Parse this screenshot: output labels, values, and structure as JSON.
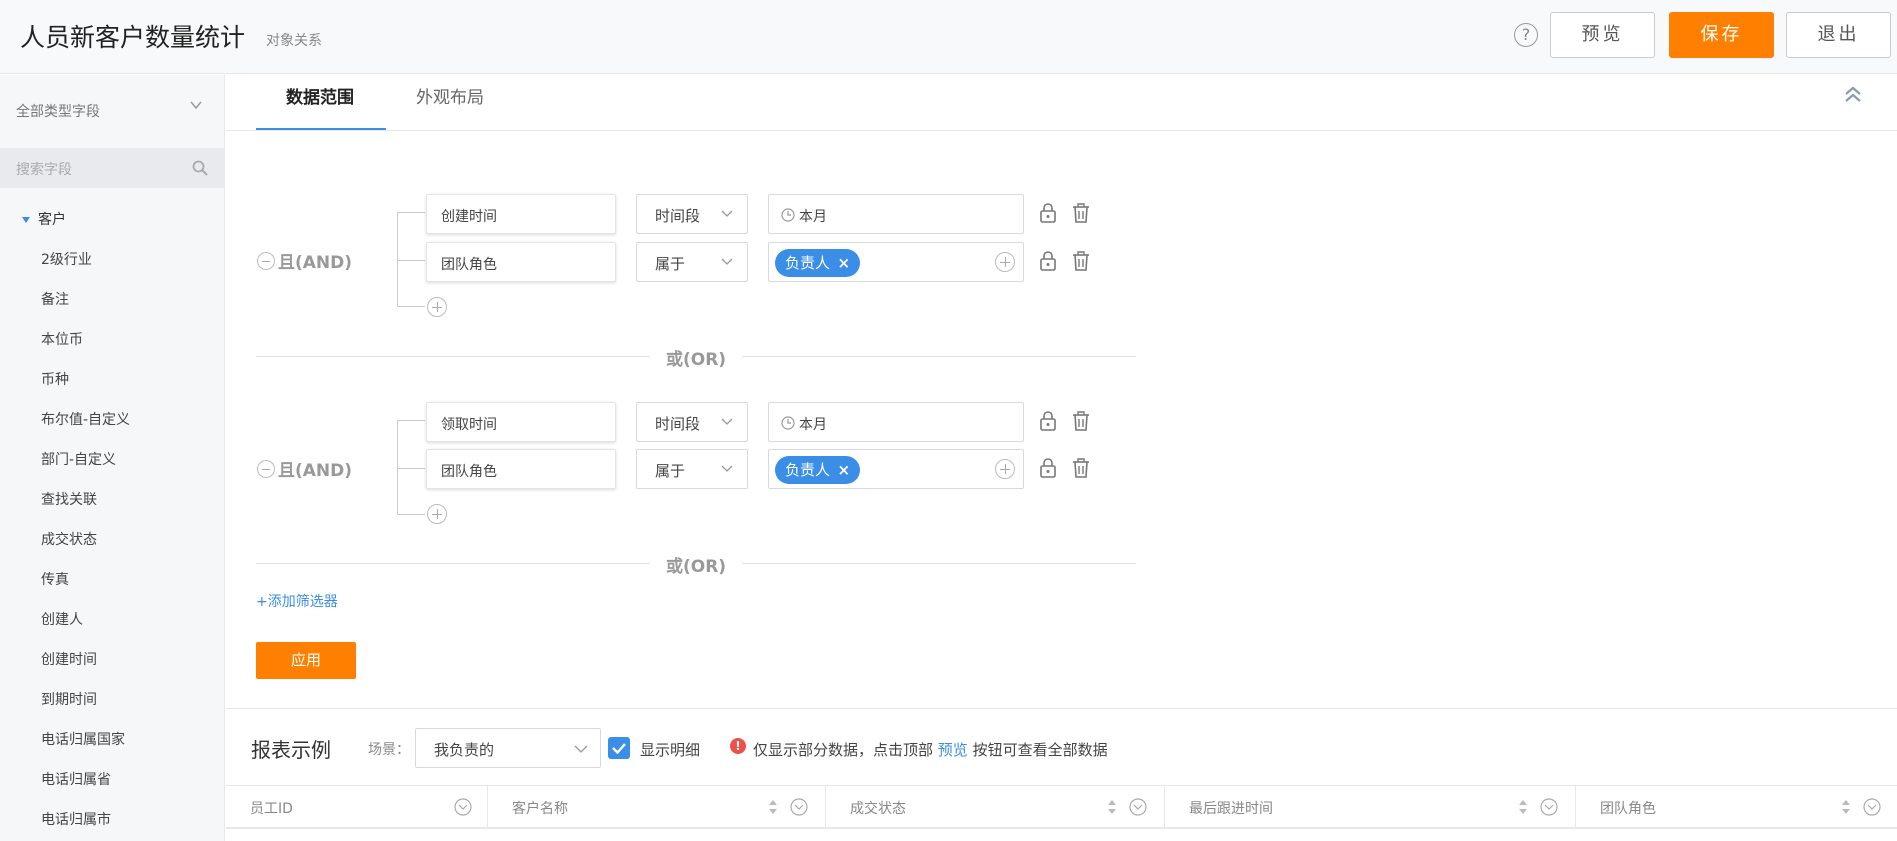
{
  "header": {
    "title": "人员新客户数量统计",
    "subtitle": "对象关系",
    "help": "?",
    "preview_label": "预览",
    "save_label": "保存",
    "exit_label": "退出"
  },
  "sidebar": {
    "field_type": "全部类型字段",
    "search_placeholder": "搜索字段",
    "root": "客户",
    "fields": [
      "2级行业",
      "备注",
      "本位币",
      "币种",
      "布尔值-自定义",
      "部门-自定义",
      "查找关联",
      "成交状态",
      "传真",
      "创建人",
      "创建时间",
      "到期时间",
      "电话归属国家",
      "电话归属省",
      "电话归属市"
    ]
  },
  "tabs": [
    {
      "label": "数据范围",
      "active": true
    },
    {
      "label": "外观布局",
      "active": false
    }
  ],
  "filters": {
    "groups": [
      {
        "logic": "且(AND)",
        "conditions": [
          {
            "field": "创建时间",
            "operator": "时间段",
            "value": "本月",
            "value_type": "date"
          },
          {
            "field": "团队角色",
            "operator": "属于",
            "tag": "负责人",
            "value_type": "tag"
          }
        ]
      },
      {
        "logic": "且(AND)",
        "conditions": [
          {
            "field": "领取时间",
            "operator": "时间段",
            "value": "本月",
            "value_type": "date"
          },
          {
            "field": "团队角色",
            "operator": "属于",
            "tag": "负责人",
            "value_type": "tag"
          }
        ]
      }
    ],
    "or_label": "或(OR)",
    "add_filter": "+添加筛选器",
    "apply": "应用"
  },
  "report": {
    "title": "报表示例",
    "scene_label": "场景：",
    "scene_value": "我负责的",
    "show_detail": "显示明细",
    "show_detail_checked": true,
    "notice_before": "仅显示部分数据，点击顶部",
    "notice_link": "预览",
    "notice_after": "按钮可查看全部数据",
    "columns": [
      "员工ID",
      "客户名称",
      "成交状态",
      "最后跟进时间",
      "团队角色"
    ]
  },
  "colors": {
    "accent": "#ff8000",
    "primary": "#3a8ee6",
    "warning": "#f0504a"
  },
  "icons": [
    "help-icon",
    "chevron-down-icon",
    "search-icon",
    "collapse-up-icon",
    "clock-icon",
    "lock-icon",
    "trash-icon",
    "plus-circle-icon",
    "minus-circle-icon",
    "sort-icon",
    "filter-icon",
    "check-icon",
    "warning-icon"
  ]
}
